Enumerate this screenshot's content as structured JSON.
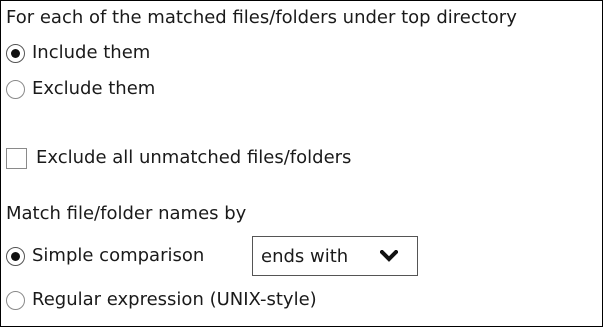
{
  "section1": {
    "heading": "For each of the matched files/folders under top directory",
    "options": [
      {
        "label": "Include them",
        "checked": true
      },
      {
        "label": "Exclude them",
        "checked": false
      }
    ]
  },
  "exclude_unmatched": {
    "label": "Exclude all unmatched files/folders",
    "checked": false
  },
  "section2": {
    "heading": "Match file/folder names by",
    "options": [
      {
        "label": "Simple comparison",
        "checked": true
      },
      {
        "label": "Regular expression (UNIX-style)",
        "checked": false
      }
    ],
    "comparison_select": {
      "value": "ends with",
      "icon": "chevron-down-icon"
    }
  }
}
